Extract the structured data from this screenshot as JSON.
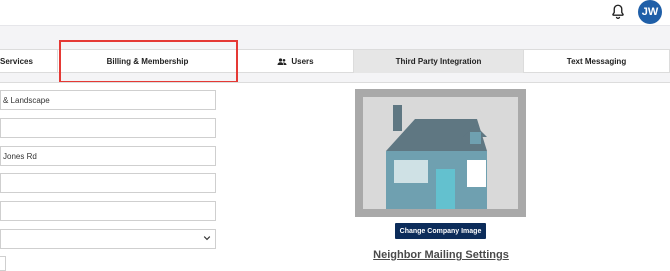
{
  "header": {
    "avatar_initials": "JW",
    "bell_icon": "bell-icon"
  },
  "tabs": [
    {
      "label": "Services",
      "icon": null
    },
    {
      "label": "Billing & Membership",
      "icon": null
    },
    {
      "label": "Users",
      "icon": "users-icon"
    },
    {
      "label": "Third Party Integration",
      "icon": null
    },
    {
      "label": "Text Messaging",
      "icon": null
    }
  ],
  "form": {
    "fields": [
      {
        "value": "& Landscape"
      },
      {
        "value": ""
      },
      {
        "value": "Jones Rd"
      },
      {
        "value": ""
      },
      {
        "value": ""
      },
      {
        "value": ""
      }
    ]
  },
  "company": {
    "change_image_label": "Change Company Image",
    "mailing_settings_label": "Neighbor Mailing Settings"
  },
  "colors": {
    "highlight": "#e53935",
    "primary_button": "#0c2c5a",
    "avatar": "#1f5fa8",
    "house_wall": "#6fa0b0",
    "house_roof": "#5f7782"
  }
}
